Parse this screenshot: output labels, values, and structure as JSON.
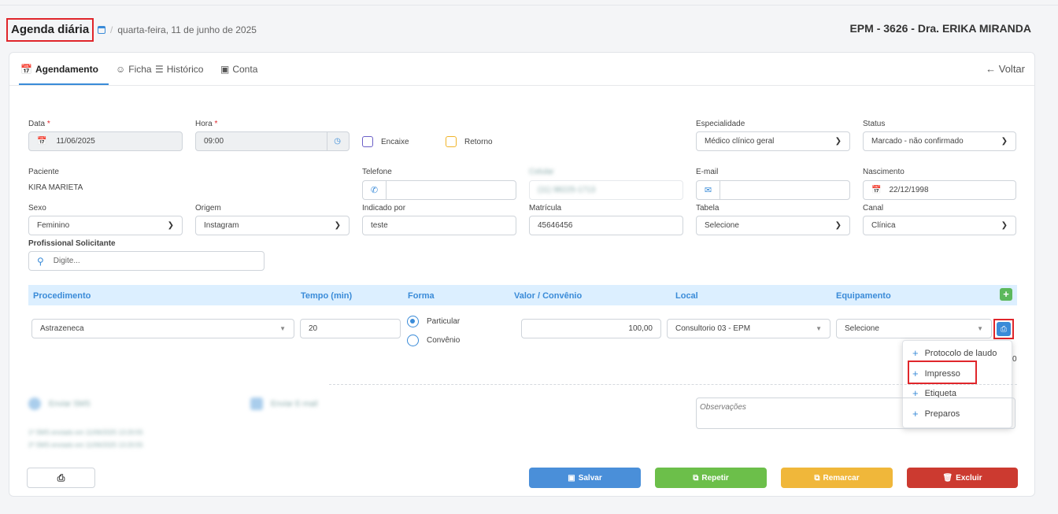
{
  "header": {
    "title": "Agenda diária",
    "separator": "/",
    "date": "quarta-feira, 11 de junho de 2025",
    "doctor": "EPM - 3626 - Dra. ERIKA MIRANDA"
  },
  "tabs": [
    {
      "label": "Agendamento"
    },
    {
      "label": "Ficha"
    },
    {
      "label": "Histórico"
    },
    {
      "label": "Conta"
    }
  ],
  "voltar": "← Voltar",
  "form": {
    "data": {
      "label": "Data",
      "required": "*",
      "value": "11/06/2025"
    },
    "hora": {
      "label": "Hora",
      "required": "*",
      "value": "09:00"
    },
    "encaixe": "Encaixe",
    "retorno": "Retorno",
    "especialidade": {
      "label": "Especialidade",
      "value": "Médico clínico geral"
    },
    "status": {
      "label": "Status",
      "value": "Marcado - não confirmado"
    },
    "paciente": {
      "label": "Paciente",
      "value": "KIRA MARIETA"
    },
    "telefone": {
      "label": "Telefone",
      "value": ""
    },
    "celular": {
      "label": "Celular",
      "value": "(11) 98225-1713"
    },
    "email": {
      "label": "E-mail",
      "value": ""
    },
    "nascimento": {
      "label": "Nascimento",
      "value": "22/12/1998"
    },
    "sexo": {
      "label": "Sexo",
      "value": "Feminino"
    },
    "origem": {
      "label": "Origem",
      "value": "Instagram"
    },
    "indicado": {
      "label": "Indicado por",
      "value": "teste"
    },
    "matricula": {
      "label": "Matrícula",
      "value": "45646456"
    },
    "tabela": {
      "label": "Tabela",
      "value": "Selecione"
    },
    "canal": {
      "label": "Canal",
      "value": "Clínica"
    },
    "profissional": {
      "label": "Profissional Solicitante",
      "placeholder": "Digite..."
    }
  },
  "procedures": {
    "headers": [
      "Procedimento",
      "Tempo (min)",
      "Forma",
      "Valor / Convênio",
      "Local",
      "Equipamento"
    ],
    "row": {
      "procedimento": "Astrazeneca",
      "tempo": "20",
      "forma_particular": "Particular",
      "forma_convenio": "Convênio",
      "valor": "100,00",
      "local": "Consultorio 03 - EPM",
      "equipamento": "Selecione",
      "partial_total": "0"
    }
  },
  "print_menu": {
    "items": [
      "Protocolo de laudo",
      "Impresso",
      "Etiqueta",
      "Preparos"
    ]
  },
  "blurred": {
    "sms": "Enviar SMS",
    "email": "Enviar E-mail",
    "line1": "1º SMS enviado em 11/06/2025 13:20:55",
    "line2": "2º SMS enviado em 11/06/2025 13:20:55"
  },
  "observacoes_placeholder": "Observações",
  "buttons": {
    "salvar": "Salvar",
    "repetir": "Repetir",
    "remarcar": "Remarcar",
    "excluir": "Excluir"
  },
  "colors": {
    "accent": "#3a8bd8",
    "salvar": "#4a8fd9",
    "repetir": "#6cbf4a",
    "remarcar": "#f0b73a",
    "excluir": "#cc3a30",
    "highlight": "#e0262b"
  }
}
